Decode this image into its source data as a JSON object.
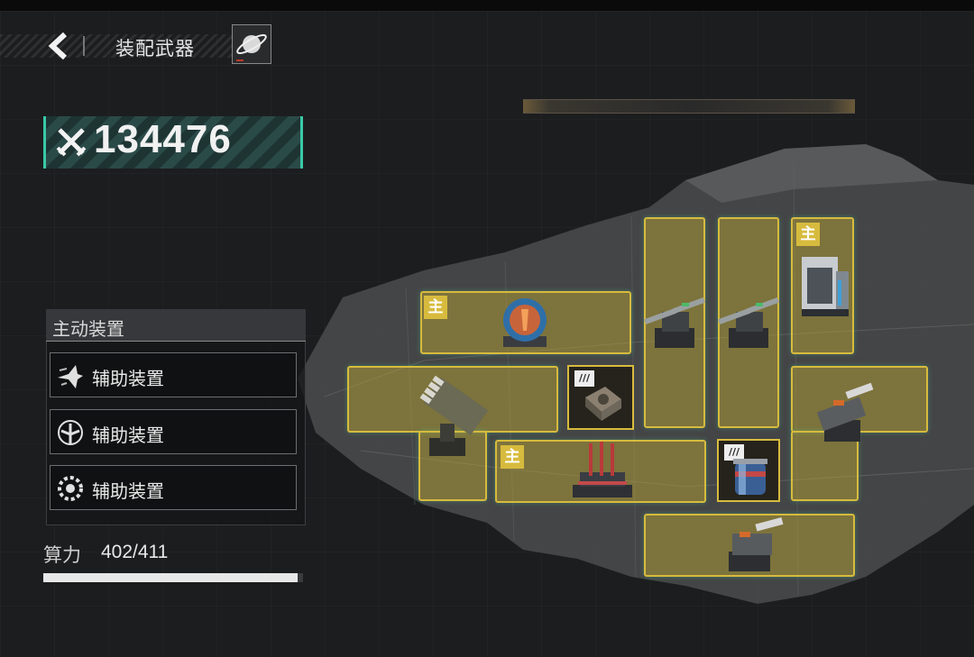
{
  "header": {
    "title": "装配武器",
    "back_icon": "chevron-left-icon",
    "planet_icon": "planet-icon"
  },
  "power": {
    "icon": "crossed-swords-icon",
    "value": "134476"
  },
  "panel": {
    "title": "主动装置",
    "slots": [
      {
        "label": "辅助装置",
        "icon": "aircraft-icon"
      },
      {
        "label": "辅助装置",
        "icon": "target-wings-icon"
      },
      {
        "label": "辅助装置",
        "icon": "gear-target-icon"
      }
    ]
  },
  "compute": {
    "label": "算力",
    "value": "402/411",
    "used": 402,
    "max": 411
  },
  "badges": {
    "main": "主",
    "level": "///"
  },
  "colors": {
    "accent_teal": "#39c9a6",
    "slot_gold": "#d7bb3e",
    "background": "#1c1d1f"
  }
}
